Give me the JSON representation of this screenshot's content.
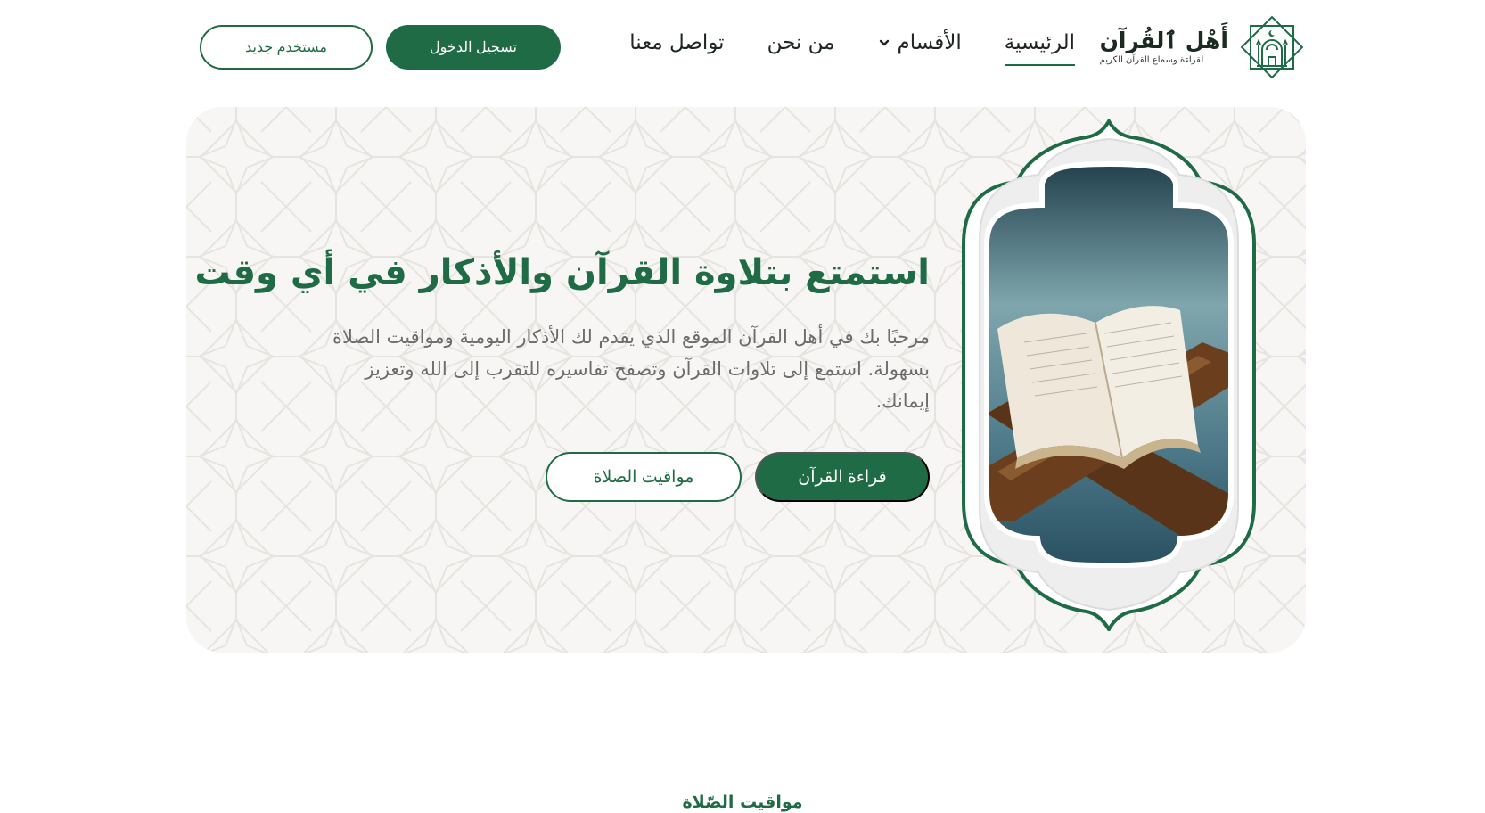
{
  "logo": {
    "title": "أَهْل ٱلقُرآن",
    "subtitle": "لقراءة وسماع القرآن الكريم"
  },
  "nav": {
    "home": "الرئيسية",
    "sections": "الأقسام",
    "about": "من نحن",
    "contact": "تواصل معنا"
  },
  "auth": {
    "login": "تسجيل الدخول",
    "register": "مستخدم جديد"
  },
  "hero": {
    "title": "استمتع بتلاوة القرآن والأذكار في أي وقت ومكان",
    "description": "مرحبًا بك في أهل القرآن الموقع الذي يقدم لك الأذكار اليومية ومواقيت الصلاة بسهولة. استمع إلى تلاوات القرآن وتصفح تفاسيره للتقرب إلى الله وتعزيز إيمانك.",
    "read_button": "قراءة القرآن",
    "prayer_button": "مواقيت الصلاة"
  },
  "section": {
    "prayer_times_title": "مواقيت الصّلاة"
  },
  "colors": {
    "brand_green": "#1f6b45",
    "hero_bg": "#f7f6f4"
  },
  "icons": {
    "logo": "mosque-logo-icon",
    "sections_dropdown": "chevron-down-icon"
  }
}
